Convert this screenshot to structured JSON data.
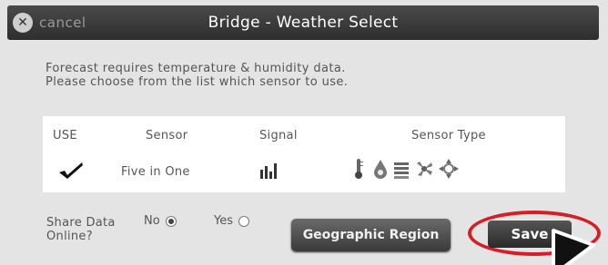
{
  "dialog": {
    "cancel_label": "cancel",
    "title": "Bridge - Weather Select",
    "message_line1": "Forecast requires temperature & humidity data.",
    "message_line2": "Please choose from the list which sensor to use."
  },
  "table": {
    "headers": [
      "USE",
      "Sensor",
      "Signal",
      "Sensor Type"
    ],
    "rows": [
      {
        "selected": true,
        "sensor": "Five in One",
        "signal_icon": "signal-bars-icon",
        "sensor_type_icons": [
          "thermometer-icon",
          "raindrop-icon",
          "rain-gauge-icon",
          "wind-fan-icon",
          "wind-direction-icon"
        ]
      }
    ]
  },
  "share": {
    "label_line1": "Share Data",
    "label_line2": "Online?",
    "options": [
      {
        "label": "No",
        "selected": true
      },
      {
        "label": "Yes",
        "selected": false
      }
    ]
  },
  "buttons": {
    "geographic_region": "Geographic Region",
    "save": "Save"
  },
  "colors": {
    "highlight_ring": "#d41f26",
    "titlebar": "#3a3a3a"
  }
}
